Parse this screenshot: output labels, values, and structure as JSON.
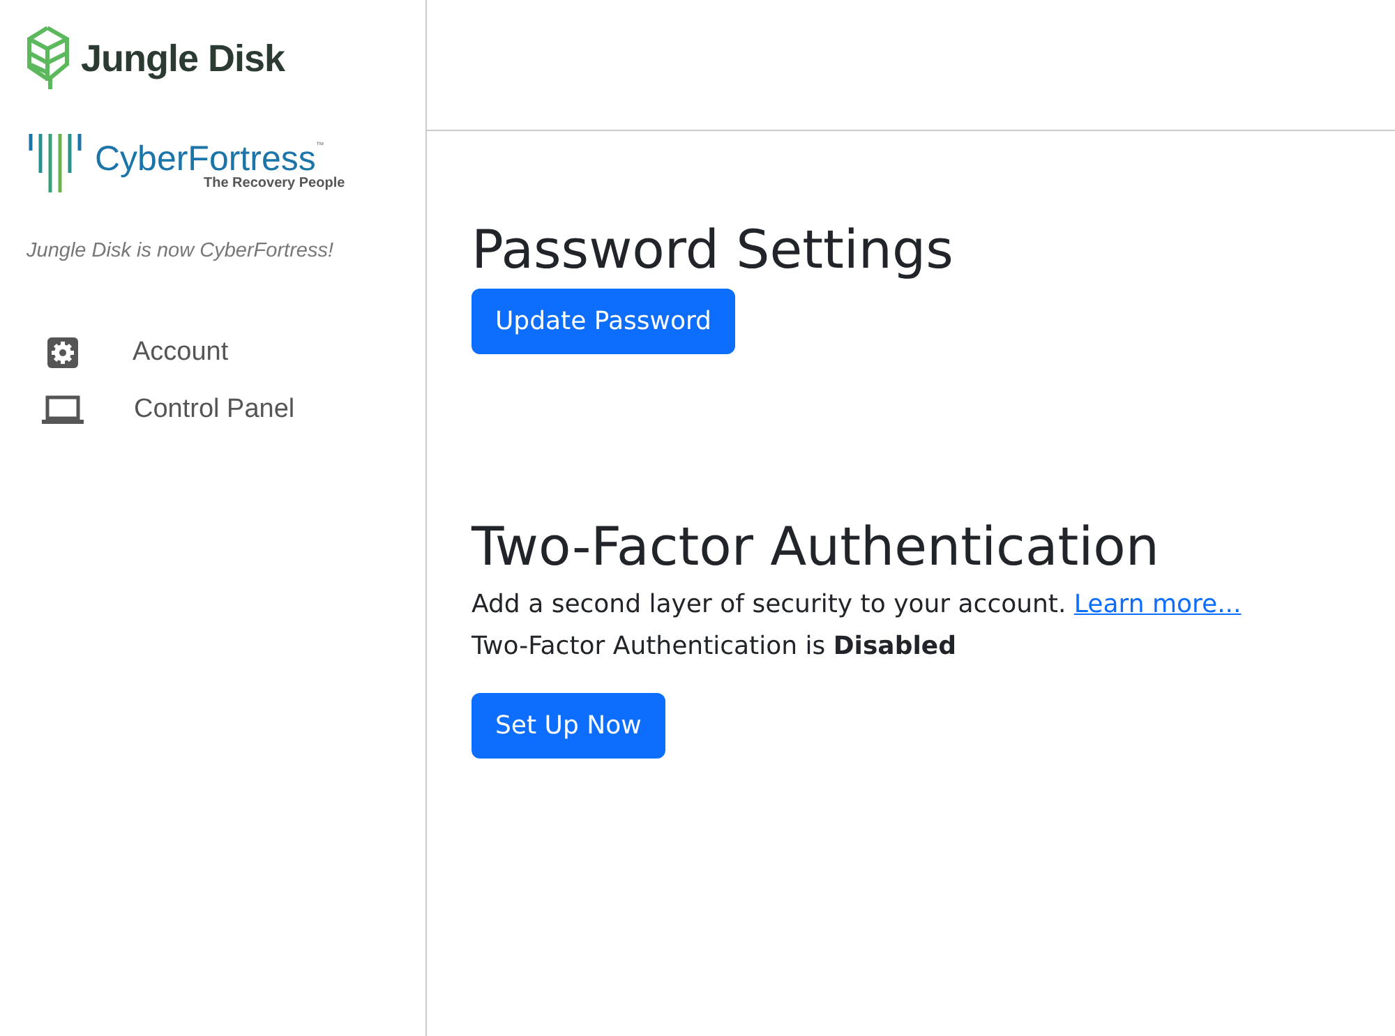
{
  "sidebar": {
    "brand": "Jungle Disk",
    "partner": {
      "name": "CyberFortress",
      "trademark": "™",
      "tagline": "The Recovery People"
    },
    "notice": "Jungle Disk is now CyberFortress!",
    "items": [
      {
        "label": "Account"
      },
      {
        "label": "Control Panel"
      }
    ]
  },
  "password": {
    "title": "Password Settings",
    "button": "Update Password"
  },
  "two_factor": {
    "title": "Two-Factor Authentication",
    "description": "Add a second layer of security to your account.",
    "link": "Learn more...",
    "status": "Two-Factor Authentication is **Disabled**",
    "button": "Set Up Now"
  }
}
